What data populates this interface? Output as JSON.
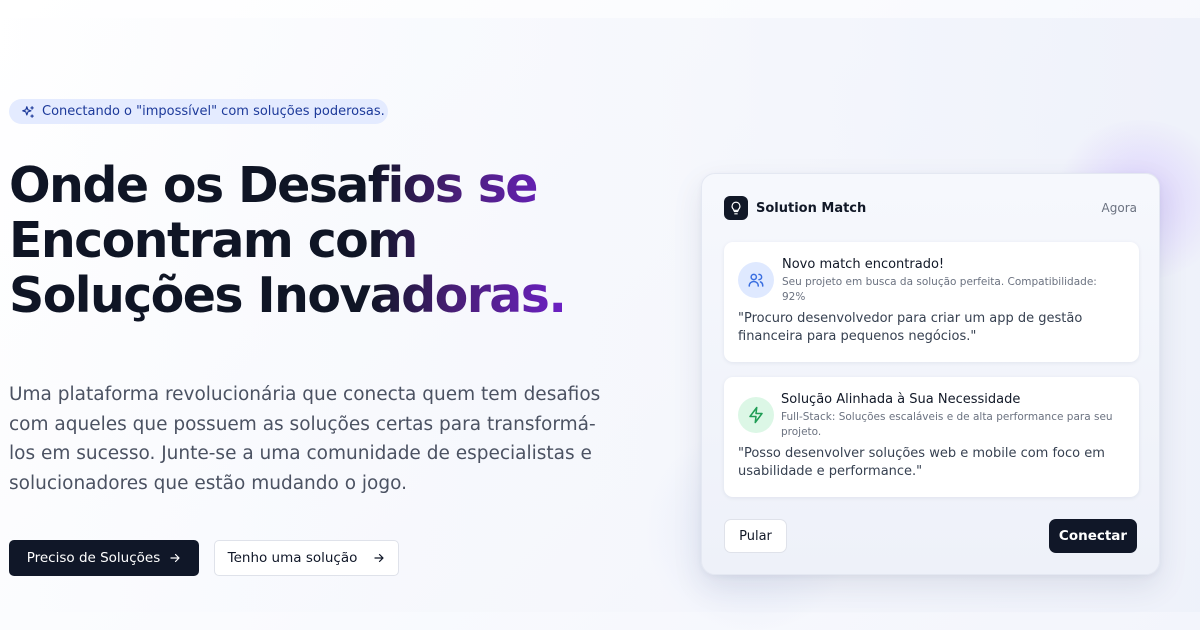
{
  "hero": {
    "badge_text": "Conectando o \"impossível\" com soluções poderosas.",
    "badge_icon": "sparkles-icon",
    "headline_lines": [
      "Onde os Desafios se",
      "Encontram com",
      "Soluções Inovadoras."
    ],
    "description": "Uma plataforma revolucionária que conecta quem tem desafios com aqueles que possuem as soluções certas para transformá-los em sucesso. Junte-se a uma comunidade de especialistas e solucionadores que estão mudando o jogo.",
    "primary_button": "Preciso de Soluções",
    "secondary_button": "Tenho uma solução",
    "accent_gradient": [
      "#0f1525",
      "#6d21c6"
    ]
  },
  "card": {
    "title": "Solution Match",
    "timestamp": "Agora",
    "header_icon": "lightbulb-icon",
    "matches": [
      {
        "icon": "users-icon",
        "title": "Novo match encontrado!",
        "subtitle": "Seu projeto em busca da solução perfeita. Compatibilidade: 92%",
        "quote": "\"Procuro desenvolvedor para criar um app de gestão financeira para pequenos negócios.\""
      },
      {
        "icon": "zap-icon",
        "title": "Solução Alinhada à Sua Necessidade",
        "subtitle": "Full-Stack: Soluções escaláveis e de alta performance para seu projeto.",
        "quote": "\"Posso desenvolver soluções web e mobile com foco em usabilidade e performance.\""
      }
    ],
    "skip_button": "Pular",
    "connect_button": "Conectar"
  },
  "colors": {
    "dark": "#101728",
    "badge_bg": "#e4ebff",
    "badge_text": "#1d3a9a",
    "match_blue": "#dfe9ff",
    "match_green": "#dcf7e6"
  }
}
